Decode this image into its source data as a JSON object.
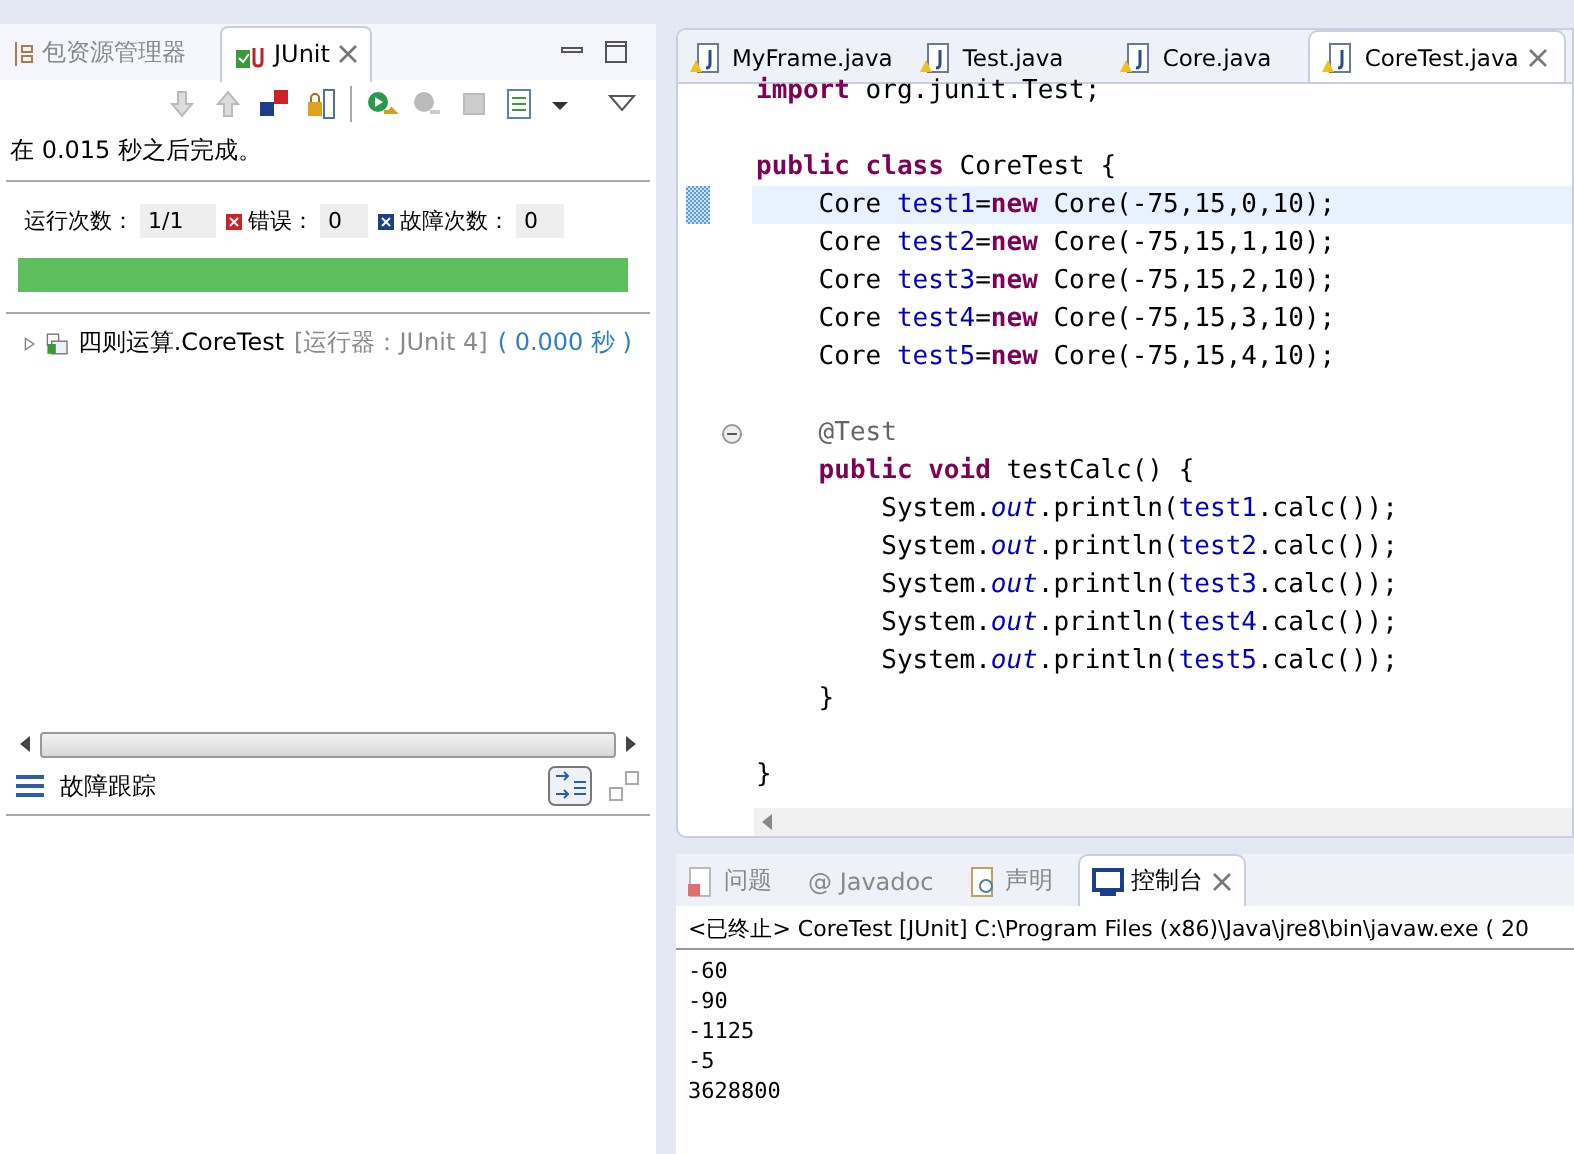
{
  "left_view": {
    "tabs": [
      {
        "label": "包资源管理器",
        "selected": false
      },
      {
        "label": "JUnit",
        "selected": true
      }
    ],
    "status": "在 0.015 秒之后完成。",
    "counters": [
      {
        "kind": "runs",
        "label": "运行次数：",
        "value": "1/1"
      },
      {
        "kind": "errors",
        "label": "错误：",
        "value": "0"
      },
      {
        "kind": "failures",
        "label": "故障次数：",
        "value": "0"
      }
    ],
    "progress": {
      "level": 1
    },
    "tree": [
      {
        "name": "四则运算.CoreTest",
        "runner": "[运行器：JUnit 4]",
        "time": "( 0.000 秒 )",
        "expanded": false
      }
    ],
    "trace_title": "故障跟踪"
  },
  "editor": {
    "tabs": [
      {
        "label": "MyFrame.java",
        "selected": false
      },
      {
        "label": "Test.java",
        "selected": false
      },
      {
        "label": "Core.java",
        "selected": false
      },
      {
        "label": "CoreTest.java",
        "selected": true
      }
    ],
    "lines": [
      {
        "kind": "code",
        "tokens": [
          {
            "kind": "kw",
            "text": "import"
          },
          {
            "kind": "text",
            "text": " org.junit.Test;"
          }
        ]
      },
      {
        "kind": "blank"
      },
      {
        "kind": "code",
        "tokens": [
          {
            "kind": "kw",
            "text": "public class"
          },
          {
            "kind": "text",
            "text": " CoreTest {"
          }
        ]
      },
      {
        "kind": "code",
        "current": true,
        "tokens": [
          {
            "kind": "text",
            "text": "    Core "
          },
          {
            "kind": "field",
            "text": "test1"
          },
          {
            "kind": "text",
            "text": "="
          },
          {
            "kind": "kw",
            "text": "new"
          },
          {
            "kind": "text",
            "text": " Core(-75,15,0,10);"
          }
        ]
      },
      {
        "kind": "code",
        "tokens": [
          {
            "kind": "text",
            "text": "    Core "
          },
          {
            "kind": "field",
            "text": "test2"
          },
          {
            "kind": "text",
            "text": "="
          },
          {
            "kind": "kw",
            "text": "new"
          },
          {
            "kind": "text",
            "text": " Core(-75,15,1,10);"
          }
        ]
      },
      {
        "kind": "code",
        "tokens": [
          {
            "kind": "text",
            "text": "    Core "
          },
          {
            "kind": "field",
            "text": "test3"
          },
          {
            "kind": "text",
            "text": "="
          },
          {
            "kind": "kw",
            "text": "new"
          },
          {
            "kind": "text",
            "text": " Core(-75,15,2,10);"
          }
        ]
      },
      {
        "kind": "code",
        "tokens": [
          {
            "kind": "text",
            "text": "    Core "
          },
          {
            "kind": "field",
            "text": "test4"
          },
          {
            "kind": "text",
            "text": "="
          },
          {
            "kind": "kw",
            "text": "new"
          },
          {
            "kind": "text",
            "text": " Core(-75,15,3,10);"
          }
        ]
      },
      {
        "kind": "code",
        "tokens": [
          {
            "kind": "text",
            "text": "    Core "
          },
          {
            "kind": "field",
            "text": "test5"
          },
          {
            "kind": "text",
            "text": "="
          },
          {
            "kind": "kw",
            "text": "new"
          },
          {
            "kind": "text",
            "text": " Core(-75,15,4,10);"
          }
        ]
      },
      {
        "kind": "blank"
      },
      {
        "kind": "code",
        "fold": true,
        "tokens": [
          {
            "kind": "annotation",
            "text": "    @Test"
          }
        ]
      },
      {
        "kind": "code",
        "tokens": [
          {
            "kind": "kw",
            "text": "    public void"
          },
          {
            "kind": "text",
            "text": " testCalc() {"
          }
        ]
      },
      {
        "kind": "code",
        "tokens": [
          {
            "kind": "text",
            "text": "        System."
          },
          {
            "kind": "static",
            "text": "out"
          },
          {
            "kind": "text",
            "text": ".println("
          },
          {
            "kind": "field",
            "text": "test1"
          },
          {
            "kind": "text",
            "text": ".calc());"
          }
        ]
      },
      {
        "kind": "code",
        "tokens": [
          {
            "kind": "text",
            "text": "        System."
          },
          {
            "kind": "static",
            "text": "out"
          },
          {
            "kind": "text",
            "text": ".println("
          },
          {
            "kind": "field",
            "text": "test2"
          },
          {
            "kind": "text",
            "text": ".calc());"
          }
        ]
      },
      {
        "kind": "code",
        "tokens": [
          {
            "kind": "text",
            "text": "        System."
          },
          {
            "kind": "static",
            "text": "out"
          },
          {
            "kind": "text",
            "text": ".println("
          },
          {
            "kind": "field",
            "text": "test3"
          },
          {
            "kind": "text",
            "text": ".calc());"
          }
        ]
      },
      {
        "kind": "code",
        "tokens": [
          {
            "kind": "text",
            "text": "        System."
          },
          {
            "kind": "static",
            "text": "out"
          },
          {
            "kind": "text",
            "text": ".println("
          },
          {
            "kind": "field",
            "text": "test4"
          },
          {
            "kind": "text",
            "text": ".calc());"
          }
        ]
      },
      {
        "kind": "code",
        "tokens": [
          {
            "kind": "text",
            "text": "        System."
          },
          {
            "kind": "static",
            "text": "out"
          },
          {
            "kind": "text",
            "text": ".println("
          },
          {
            "kind": "field",
            "text": "test5"
          },
          {
            "kind": "text",
            "text": ".calc());"
          }
        ]
      },
      {
        "kind": "code",
        "tokens": [
          {
            "kind": "text",
            "text": "    }"
          }
        ]
      },
      {
        "kind": "blank"
      },
      {
        "kind": "code",
        "tokens": [
          {
            "kind": "text",
            "text": "}"
          }
        ]
      }
    ]
  },
  "console": {
    "tabs": [
      {
        "label": "问题",
        "selected": false
      },
      {
        "label": "@ Javadoc",
        "selected": false
      },
      {
        "label": "声明",
        "selected": false
      },
      {
        "label": "控制台",
        "selected": true
      }
    ],
    "header": "<已终止> CoreTest [JUnit] C:\\Program Files (x86)\\Java\\jre8\\bin\\javaw.exe ( 20",
    "output": [
      "-60",
      "-90",
      "-1125",
      "-5",
      "3628800"
    ]
  }
}
